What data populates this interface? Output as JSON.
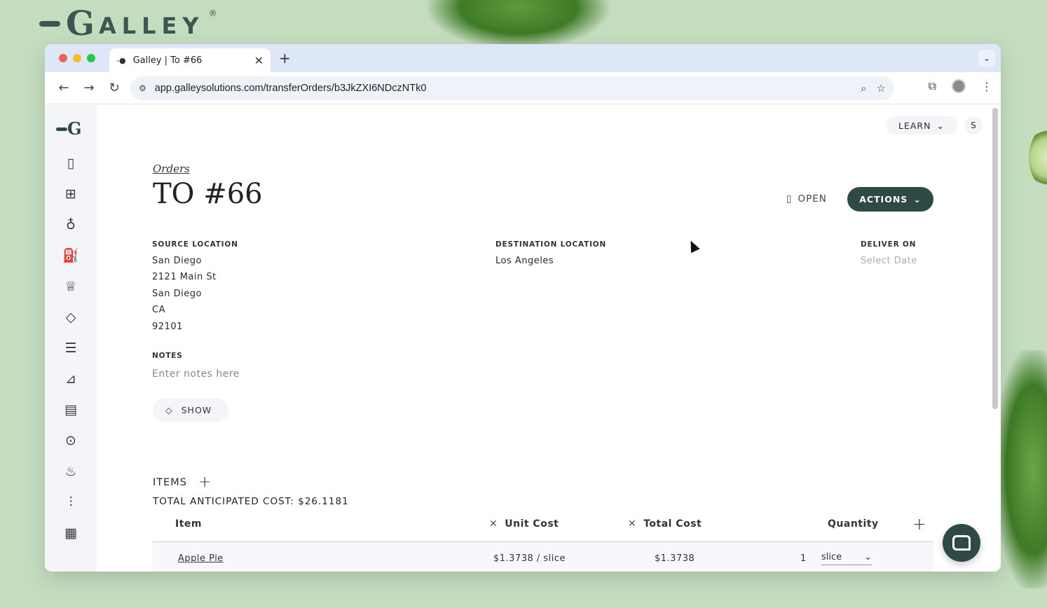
{
  "brand": {
    "first_letter": "G",
    "rest": "ALLEY",
    "registered": "®"
  },
  "colors": {
    "accent": "#2f4a45",
    "background": "#c4ddbf",
    "tabbar": "#dde7f7"
  },
  "browser": {
    "tab_title": "Galley | To #66",
    "url": "app.galleysolutions.com/transferOrders/b3JkZXI6NDczNTk0"
  },
  "sidebar": {
    "items": [
      "clipboard-icon",
      "book-icon",
      "ingredient-icon",
      "bottle-icon",
      "chef-icon",
      "tag-icon",
      "checklist-icon",
      "cart-icon",
      "document-icon",
      "location-icon",
      "dining-icon",
      "sliders-icon",
      "menu-icon"
    ]
  },
  "header": {
    "learn_label": "LEARN",
    "user_initial": "S"
  },
  "page": {
    "breadcrumb": "Orders",
    "title": "TO #66",
    "status": "OPEN",
    "actions_label": "ACTIONS"
  },
  "source": {
    "label": "SOURCE LOCATION",
    "lines": [
      "San Diego",
      "2121 Main St",
      "San Diego",
      "CA",
      "92101"
    ]
  },
  "destination": {
    "label": "DESTINATION LOCATION",
    "value": "Los Angeles"
  },
  "deliver": {
    "label": "DELIVER ON",
    "placeholder": "Select Date"
  },
  "notes": {
    "label": "NOTES",
    "placeholder": "Enter notes here"
  },
  "show_label": "SHOW",
  "items": {
    "heading": "ITEMS",
    "total": "TOTAL ANTICIPATED COST: $26.1181",
    "columns": {
      "item": "Item",
      "unit_cost": "Unit Cost",
      "total_cost": "Total Cost",
      "quantity": "Quantity"
    },
    "rows": [
      {
        "item": "Apple Pie",
        "unit_cost": "$1.3738 / slice",
        "total_cost": "$1.3738",
        "qty": "1",
        "unit": "slice"
      }
    ]
  }
}
